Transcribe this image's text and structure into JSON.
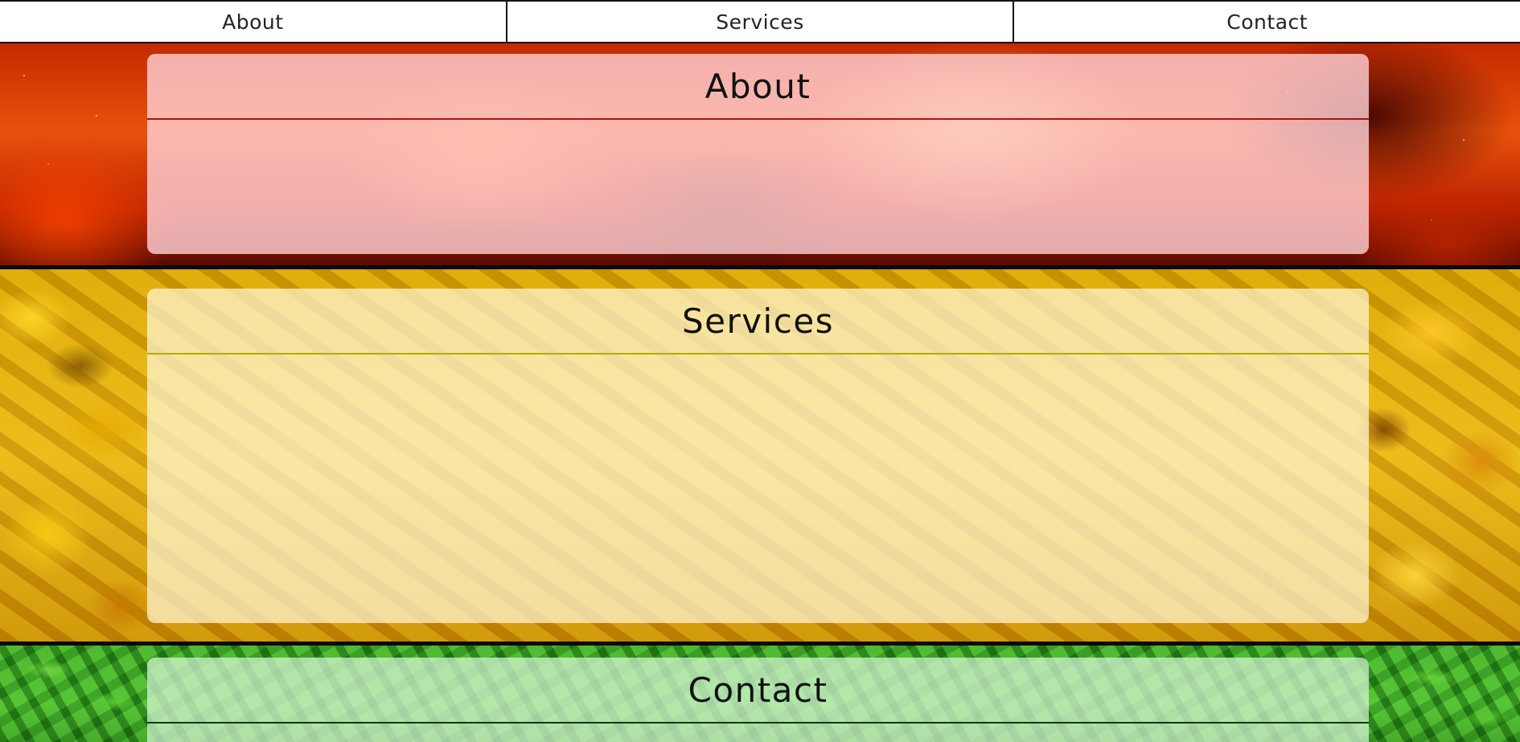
{
  "nav": {
    "items": [
      {
        "label": "About"
      },
      {
        "label": "Services"
      },
      {
        "label": "Contact"
      }
    ]
  },
  "sections": {
    "about": {
      "title": "About",
      "accent_color": "#b01010"
    },
    "services": {
      "title": "Services",
      "accent_color": "#b8a800"
    },
    "contact": {
      "title": "Contact",
      "accent_color": "#0e3a0e"
    }
  }
}
